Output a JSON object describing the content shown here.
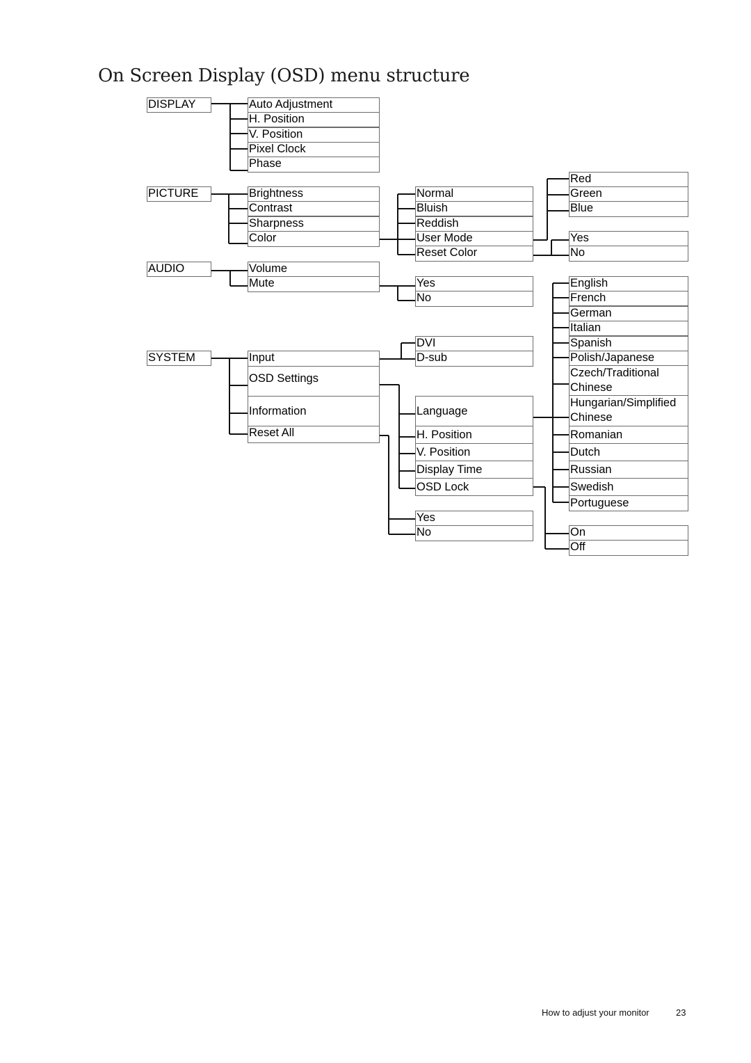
{
  "page": {
    "title": "On Screen Display (OSD) menu structure",
    "footer": {
      "section": "How to adjust your monitor",
      "page_number": "23"
    }
  },
  "menu": {
    "display": {
      "label": "DISPLAY",
      "items": [
        "Auto Adjustment",
        "H. Position",
        "V. Position",
        "Pixel Clock",
        "Phase"
      ]
    },
    "picture": {
      "label": "PICTURE",
      "items": [
        "Brightness",
        "Contrast",
        "Sharpness",
        "Color"
      ],
      "color_options": [
        "Normal",
        "Bluish",
        "Reddish",
        "User Mode",
        "Reset Color"
      ],
      "user_mode_options": [
        "Red",
        "Green",
        "Blue"
      ],
      "reset_color_options": [
        "Yes",
        "No"
      ]
    },
    "audio": {
      "label": "AUDIO",
      "items": [
        "Volume",
        "Mute"
      ],
      "mute_options": [
        "Yes",
        "No"
      ]
    },
    "system": {
      "label": "SYSTEM",
      "items": [
        "Input",
        "OSD Settings",
        "Information",
        "Reset All"
      ],
      "input_options": [
        "DVI",
        "D-sub"
      ],
      "osd_settings_options": [
        "Language",
        "H. Position",
        "V. Position",
        "Display Time",
        "OSD Lock"
      ],
      "language_options": [
        "English",
        "French",
        "German",
        "Italian",
        "Spanish",
        "Polish/Japanese",
        "Czech/Traditional Chinese",
        "Hungarian/Simplified Chinese",
        "Romanian",
        "Dutch",
        "Russian",
        "Swedish",
        "Portuguese"
      ],
      "osd_lock_options": [
        "On",
        "Off"
      ],
      "reset_all_options": [
        "Yes",
        "No"
      ]
    }
  }
}
